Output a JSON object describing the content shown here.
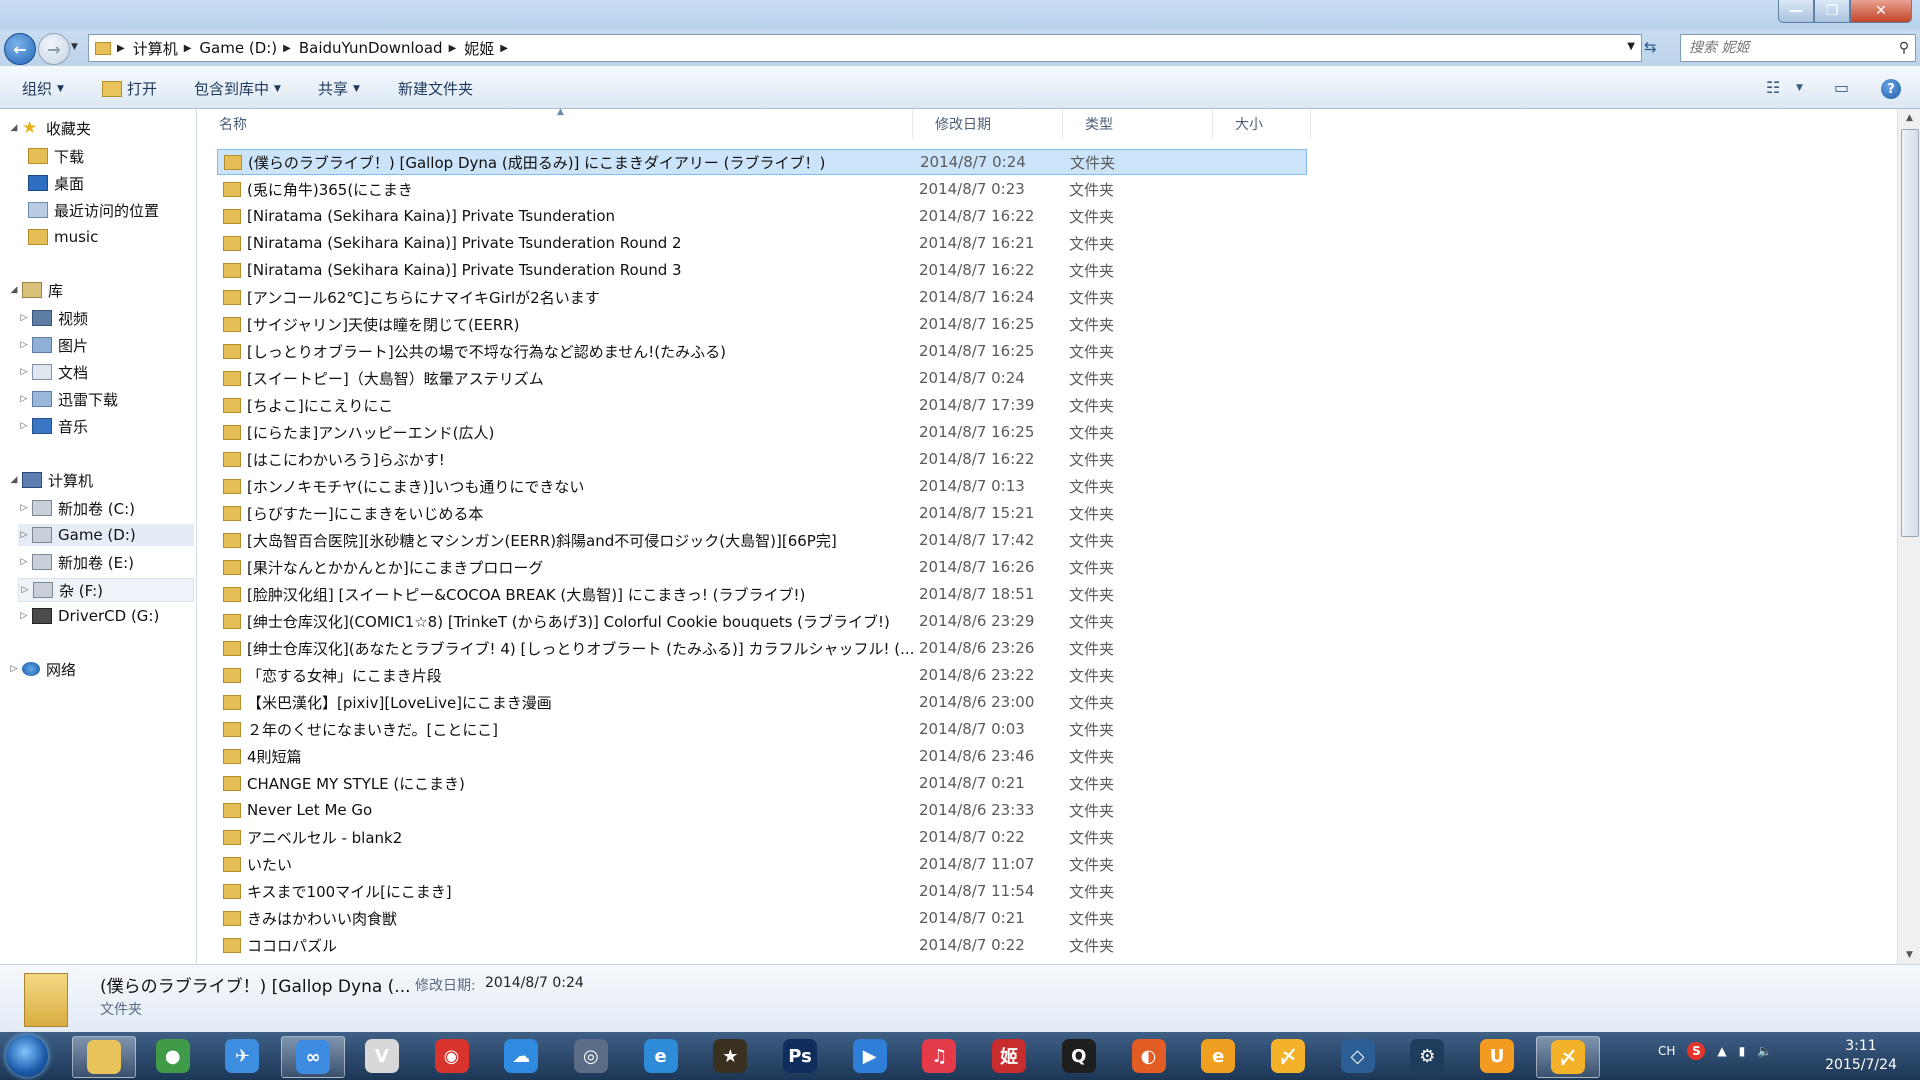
{
  "window": {
    "min": "—",
    "max": "❐",
    "close": "✕"
  },
  "address": {
    "crumbs": [
      "计算机",
      "Game (D:)",
      "BaiduYunDownload",
      "妮姬"
    ],
    "search_placeholder": "搜索 妮姬"
  },
  "toolbar": {
    "organize": "组织",
    "open": "打开",
    "include_in_library": "包含到库中",
    "share": "共享",
    "new_folder": "新建文件夹"
  },
  "nav": {
    "favorites": "收藏夹",
    "downloads": "下载",
    "desktop": "桌面",
    "recent": "最近访问的位置",
    "music_fav": "music",
    "libraries": "库",
    "videos": "视频",
    "pictures": "图片",
    "documents": "文档",
    "xunlei": "迅雷下载",
    "music_lib": "音乐",
    "computer": "计算机",
    "drive_c": "新加卷 (C:)",
    "drive_d": "Game (D:)",
    "drive_e": "新加卷 (E:)",
    "drive_f": "杂 (F:)",
    "drive_g": "DriverCD (G:)",
    "network": "网络"
  },
  "columns": {
    "name": "名称",
    "date": "修改日期",
    "type": "类型",
    "size": "大小"
  },
  "files": [
    {
      "name": "(僕らのラブライブ！) [Gallop Dyna (成田るみ)] にこまきダイアリー (ラブライブ！)",
      "date": "2014/8/7 0:24",
      "type": "文件夹"
    },
    {
      "name": "(兎に角牛)365(にこまき",
      "date": "2014/8/7 0:23",
      "type": "文件夹"
    },
    {
      "name": "[Niratama (Sekihara Kaina)] Private Tsunderation",
      "date": "2014/8/7 16:22",
      "type": "文件夹"
    },
    {
      "name": "[Niratama (Sekihara Kaina)] Private Tsunderation Round 2",
      "date": "2014/8/7 16:21",
      "type": "文件夹"
    },
    {
      "name": "[Niratama (Sekihara Kaina)] Private Tsunderation Round 3",
      "date": "2014/8/7 16:22",
      "type": "文件夹"
    },
    {
      "name": "[アンコール62℃]こちらにナマイキGirlが2名います",
      "date": "2014/8/7 16:24",
      "type": "文件夹"
    },
    {
      "name": "[サイジャリン]天使は瞳を閉じて(EERR)",
      "date": "2014/8/7 16:25",
      "type": "文件夹"
    },
    {
      "name": "[しっとりオブラート]公共の場で不埒な行為など認めません!(たみふる)",
      "date": "2014/8/7 16:25",
      "type": "文件夹"
    },
    {
      "name": "[スイートピー]（大島智）眩暈アステリズム",
      "date": "2014/8/7 0:24",
      "type": "文件夹"
    },
    {
      "name": "[ちよこ]にこえりにこ",
      "date": "2014/8/7 17:39",
      "type": "文件夹"
    },
    {
      "name": "[にらたま]アンハッピーエンド(広人)",
      "date": "2014/8/7 16:25",
      "type": "文件夹"
    },
    {
      "name": "[はこにわかいろう]らぶかす!",
      "date": "2014/8/7 16:22",
      "type": "文件夹"
    },
    {
      "name": "[ホンノキモチヤ(にこまき)]いつも通りにできない",
      "date": "2014/8/7 0:13",
      "type": "文件夹"
    },
    {
      "name": "[らびすたー]にこまきをいじめる本",
      "date": "2014/8/7 15:21",
      "type": "文件夹"
    },
    {
      "name": "[大岛智百合医院][氷砂糖とマシンガン(EERR)斜陽and不可侵ロジック(大島智)][66P完]",
      "date": "2014/8/7 17:42",
      "type": "文件夹"
    },
    {
      "name": "[果汁なんとかかんとか]にこまきプロローグ",
      "date": "2014/8/7 16:26",
      "type": "文件夹"
    },
    {
      "name": "[脸肿汉化组] [スイートピー&COCOA BREAK (大島智)] にこまきっ! (ラブライブ!)",
      "date": "2014/8/7 18:51",
      "type": "文件夹"
    },
    {
      "name": "[绅士仓库汉化](COMIC1☆8) [TrinkeT (からあげ3)] Colorful Cookie bouquets (ラブライブ!)",
      "date": "2014/8/6 23:29",
      "type": "文件夹"
    },
    {
      "name": "[绅士仓库汉化](あなたとラブライブ! 4) [しっとりオブラート (たみふる)] カラフルシャッフル! (...",
      "date": "2014/8/6 23:26",
      "type": "文件夹"
    },
    {
      "name": "「恋する女神」にこまき片段",
      "date": "2014/8/6 23:22",
      "type": "文件夹"
    },
    {
      "name": "【米巴漢化】[pixiv][LoveLive]にこまき漫画",
      "date": "2014/8/6 23:00",
      "type": "文件夹"
    },
    {
      "name": "２年のくせになまいきだ。[ことにこ]",
      "date": "2014/8/7 0:03",
      "type": "文件夹"
    },
    {
      "name": "4則短篇",
      "date": "2014/8/6 23:46",
      "type": "文件夹"
    },
    {
      "name": "CHANGE MY STYLE (にこまき)",
      "date": "2014/8/7 0:21",
      "type": "文件夹"
    },
    {
      "name": "Never Let Me Go",
      "date": "2014/8/6 23:33",
      "type": "文件夹"
    },
    {
      "name": "アニベルセル - blank2",
      "date": "2014/8/7 0:22",
      "type": "文件夹"
    },
    {
      "name": "いたい",
      "date": "2014/8/7 11:07",
      "type": "文件夹"
    },
    {
      "name": "キスまで100マイル[にこまき]",
      "date": "2014/8/7 11:54",
      "type": "文件夹"
    },
    {
      "name": "きみはかわいい肉食獣",
      "date": "2014/8/7 0:21",
      "type": "文件夹"
    },
    {
      "name": "ココロパズル",
      "date": "2014/8/7 0:22",
      "type": "文件夹"
    }
  ],
  "details": {
    "name": "(僕らのラブライブ！) [Gallop Dyna (...",
    "modified_label": "修改日期:",
    "modified_value": "2014/8/7 0:24",
    "type": "文件夹"
  },
  "taskbar": {
    "apps": [
      {
        "icon": "explorer-icon",
        "color": "#e8c35a",
        "glyph": ""
      },
      {
        "icon": "chrome-icon",
        "color": "#3f9b47",
        "glyph": "●"
      },
      {
        "icon": "mail-icon",
        "color": "#3d8ee0",
        "glyph": "✈"
      },
      {
        "icon": "cloud-sync-icon",
        "color": "#3c8be0",
        "glyph": "∞"
      },
      {
        "icon": "fox-icon",
        "color": "#d8d8d8",
        "glyph": "V"
      },
      {
        "icon": "netease-music-icon",
        "color": "#d8332c",
        "glyph": "◉"
      },
      {
        "icon": "baidu-cloud-icon",
        "color": "#2f8ae0",
        "glyph": "☁"
      },
      {
        "icon": "gamepad-icon",
        "color": "#5a6c86",
        "glyph": "◎"
      },
      {
        "icon": "browser-icon",
        "color": "#2d8bd8",
        "glyph": "e"
      },
      {
        "icon": "game-logo-icon",
        "color": "#3a3020",
        "glyph": "★"
      },
      {
        "icon": "photoshop-icon",
        "color": "#0f2d5c",
        "glyph": "Ps"
      },
      {
        "icon": "media-player-icon",
        "color": "#2f7fd8",
        "glyph": "▶"
      },
      {
        "icon": "itunes-icon",
        "color": "#e53a4a",
        "glyph": "♫"
      },
      {
        "icon": "game-app-icon",
        "color": "#c92c2c",
        "glyph": "姬"
      },
      {
        "icon": "qq-icon",
        "color": "#1f1f1f",
        "glyph": "Q"
      },
      {
        "icon": "firefox-icon",
        "color": "#e25d24",
        "glyph": "◐"
      },
      {
        "icon": "chat-app-icon",
        "color": "#f0a020",
        "glyph": "e"
      },
      {
        "icon": "feather-app-icon",
        "color": "#f3b229",
        "glyph": "〆"
      },
      {
        "icon": "game-launcher-icon",
        "color": "#2a5e94",
        "glyph": "◇"
      },
      {
        "icon": "steam-icon",
        "color": "#1f3c5c",
        "glyph": "⚙"
      },
      {
        "icon": "uc-browser-icon",
        "color": "#f39a21",
        "glyph": "U"
      },
      {
        "icon": "feather-app-icon-2",
        "color": "#f3b229",
        "glyph": "〆"
      }
    ],
    "lang": "CH",
    "ime": "S",
    "time": "3:11",
    "date": "2015/7/24"
  }
}
